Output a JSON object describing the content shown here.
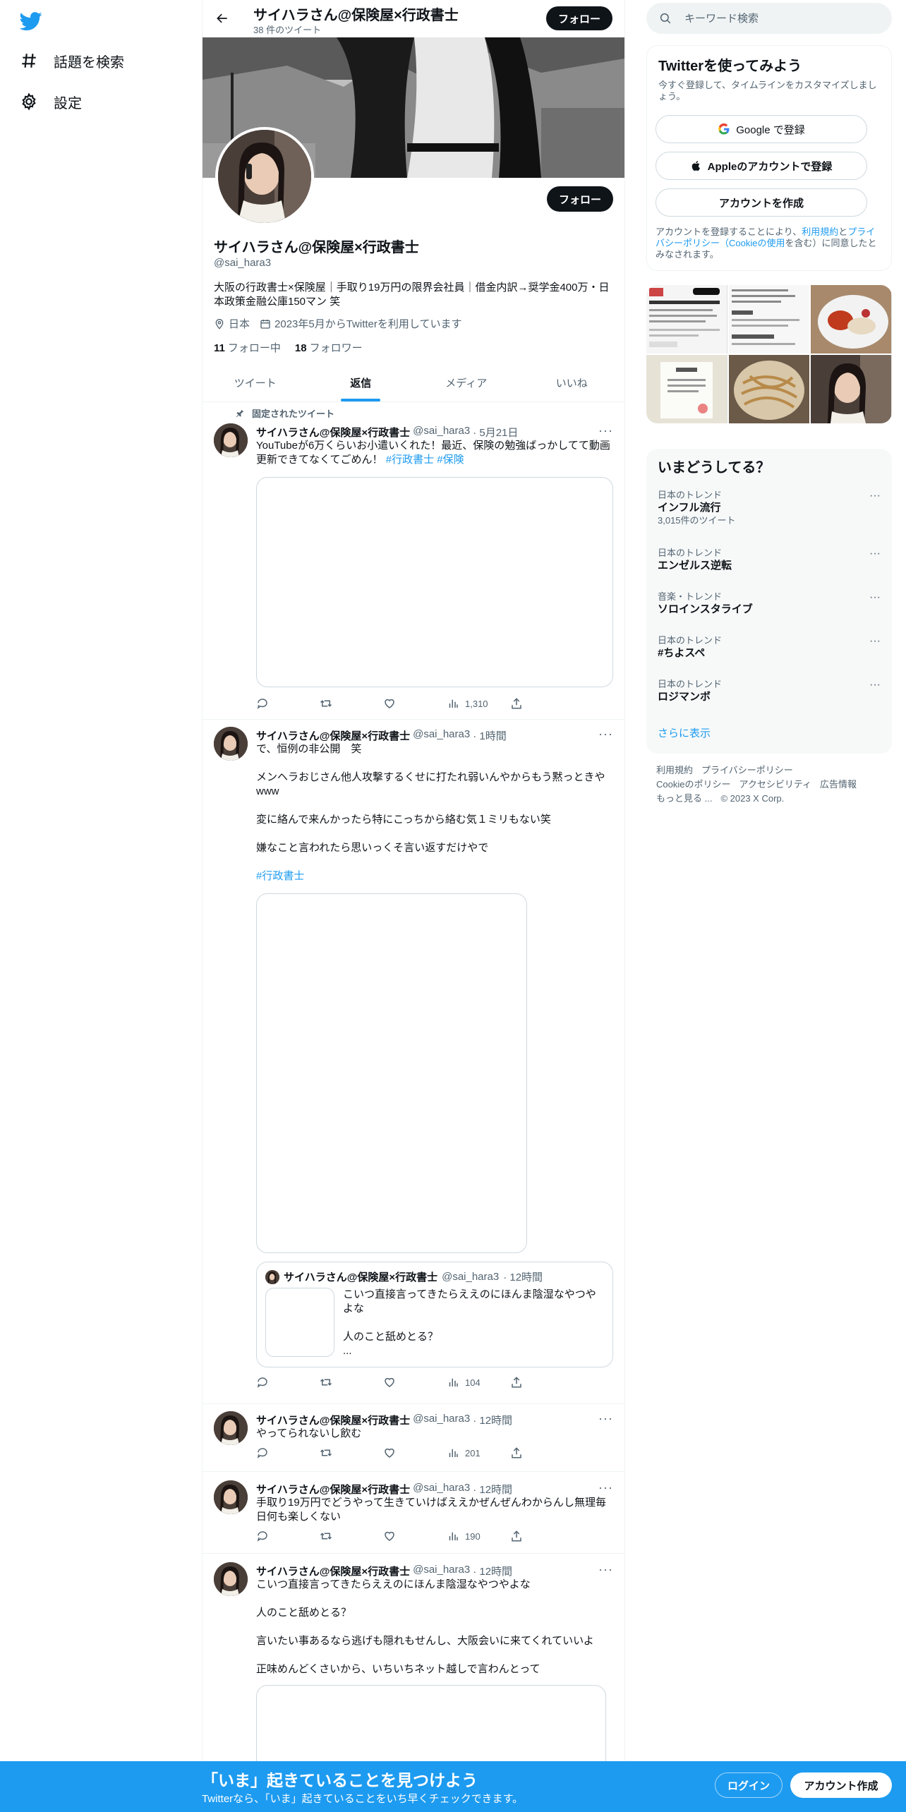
{
  "nav": {
    "explore_label": "話題を検索",
    "settings_label": "設定"
  },
  "header": {
    "title": "サイハラさん@保険屋×行政書士",
    "tweet_count": "38 件のツイート",
    "follow_label": "フォロー"
  },
  "profile": {
    "name": "サイハラさん@保険屋×行政書士",
    "handle": "@sai_hara3",
    "bio": "大阪の行政書士×保険屋｜手取り19万円の限界会社員｜借金内訳→奨学金400万・日本政策金融公庫150マン 笑",
    "location": "日本",
    "joined": "2023年5月からTwitterを利用しています",
    "following_count": "11",
    "following_label": "フォロー中",
    "followers_count": "18",
    "followers_label": "フォロワー",
    "follow_label": "フォロー"
  },
  "tabs": [
    {
      "label": "ツイート",
      "active": false
    },
    {
      "label": "返信",
      "active": true
    },
    {
      "label": "メディア",
      "active": false
    },
    {
      "label": "いいね",
      "active": false
    }
  ],
  "tweets": [
    {
      "pinned_label": "固定されたツイート",
      "name": "サイハラさん@保険屋×行政書士",
      "handle": "@sai_hara3",
      "time": "· 5月21日",
      "text": "YouTubeが6万くらいお小遣いくれた！最近、保険の勉強ばっかしてて動画更新できてなくてごめん！",
      "hashtags": "#行政書士 #保険",
      "views": "1,310"
    },
    {
      "name": "サイハラさん@保険屋×行政書士",
      "handle": "@sai_hara3",
      "time": "· 1時間",
      "text": "で、恒例の非公開　笑\n\nメンヘラおじさん他人攻撃するくせに打たれ弱いんやからもう黙っときやwww\n\n変に絡んで来んかったら特にこっちから絡む気１ミリもない笑\n\n嫌なこと言われたら思いっくそ言い返すだけやで",
      "hashtag": "#行政書士",
      "quote": {
        "name": "サイハラさん@保険屋×行政書士",
        "handle": "@sai_hara3",
        "time": "· 12時間",
        "text": "こいつ直接言ってきたらええのにほんま陰湿なやつやよな\n\n人のこと舐めとる？\n..."
      },
      "views": "104"
    },
    {
      "name": "サイハラさん@保険屋×行政書士",
      "handle": "@sai_hara3",
      "time": "· 12時間",
      "text": "やってられないし飲む",
      "views": "201"
    },
    {
      "name": "サイハラさん@保険屋×行政書士",
      "handle": "@sai_hara3",
      "time": "· 12時間",
      "text": "手取り19万円でどうやって生きていけばええかぜんぜんわからんし無理毎日何も楽しくない",
      "views": "190"
    },
    {
      "name": "サイハラさん@保険屋×行政書士",
      "handle": "@sai_hara3",
      "time": "· 12時間",
      "text": "こいつ直接言ってきたらええのにほんま陰湿なやつやよな\n\n人のこと舐めとる？\n\n言いたい事あるなら逃げも隠れもせんし、大阪会いに来てくれていいよ\n\n正味めんどくさいから、いちいちネット越しで言わんとって"
    }
  ],
  "search": {
    "placeholder": "キーワード検索"
  },
  "signup": {
    "title": "Twitterを使ってみよう",
    "subtitle": "今すぐ登録して、タイムラインをカスタマイズしましょう。",
    "google_label": "Google で登録",
    "apple_label": "Appleのアカウントで登録",
    "create_label": "アカウントを作成",
    "terms_prefix": "アカウントを登録することにより、",
    "terms_link": "利用規約",
    "terms_and": "と",
    "privacy_link": "プライバシーポリシー（Cookieの使用",
    "terms_suffix": "を含む）に同意したとみなされます。"
  },
  "trends": {
    "title": "いまどうしてる？",
    "items": [
      {
        "context": "日本のトレンド",
        "name": "インフル流行",
        "count": "3,015件のツイート"
      },
      {
        "context": "日本のトレンド",
        "name": "エンゼルス逆転",
        "count": ""
      },
      {
        "context": "音楽・トレンド",
        "name": "ソロインスタライブ",
        "count": ""
      },
      {
        "context": "日本のトレンド",
        "name": "#ちよスペ",
        "count": ""
      },
      {
        "context": "日本のトレンド",
        "name": "ロジマンボ",
        "count": ""
      }
    ],
    "show_more": "さらに表示"
  },
  "footer": {
    "links": [
      "利用規約",
      "プライバシーポリシー",
      "Cookieのポリシー",
      "アクセシビリティ",
      "広告情報",
      "もっと見る ..."
    ],
    "copyright": "© 2023 X Corp."
  },
  "bottom_bar": {
    "title": "「いま」起きていることを見つけよう",
    "subtitle": "Twitterなら、「いま」起きていることをいち早くチェックできます。",
    "login_label": "ログイン",
    "signup_label": "アカウント作成"
  },
  "colors": {
    "accent": "#1d9bf0",
    "text": "#0f1419",
    "secondary": "#536471"
  }
}
